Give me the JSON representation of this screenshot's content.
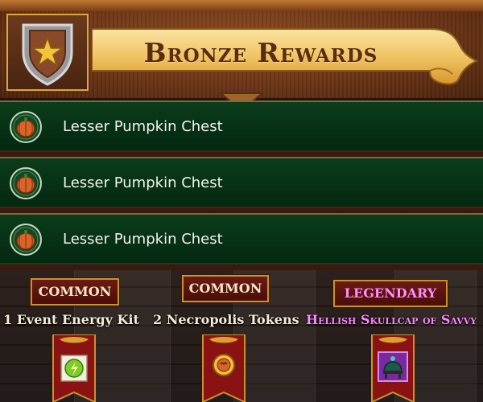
{
  "header": {
    "title": "Bronze Rewards",
    "badge_icon": "shield-star-icon"
  },
  "rewards": [
    {
      "label": "Lesser Pumpkin Chest",
      "icon": "pumpkin-chest-icon"
    },
    {
      "label": "Lesser Pumpkin Chest",
      "icon": "pumpkin-chest-icon"
    },
    {
      "label": "Lesser Pumpkin Chest",
      "icon": "pumpkin-chest-icon"
    }
  ],
  "items": [
    {
      "rarity": "COMMON",
      "name": "1 Event Energy Kit",
      "icon": "energy-kit-icon"
    },
    {
      "rarity": "COMMON",
      "name": "2 Necropolis Tokens",
      "icon": "necropolis-token-icon"
    },
    {
      "rarity": "LEGENDARY",
      "name": "Hellish Skullcap of Savvy",
      "icon": "skullcap-helmet-icon"
    }
  ],
  "colors": {
    "row_green": "#063014",
    "common_text": "#f4e7c8",
    "legendary_text": "#ff86ff",
    "gold_border": "#c9922f"
  }
}
